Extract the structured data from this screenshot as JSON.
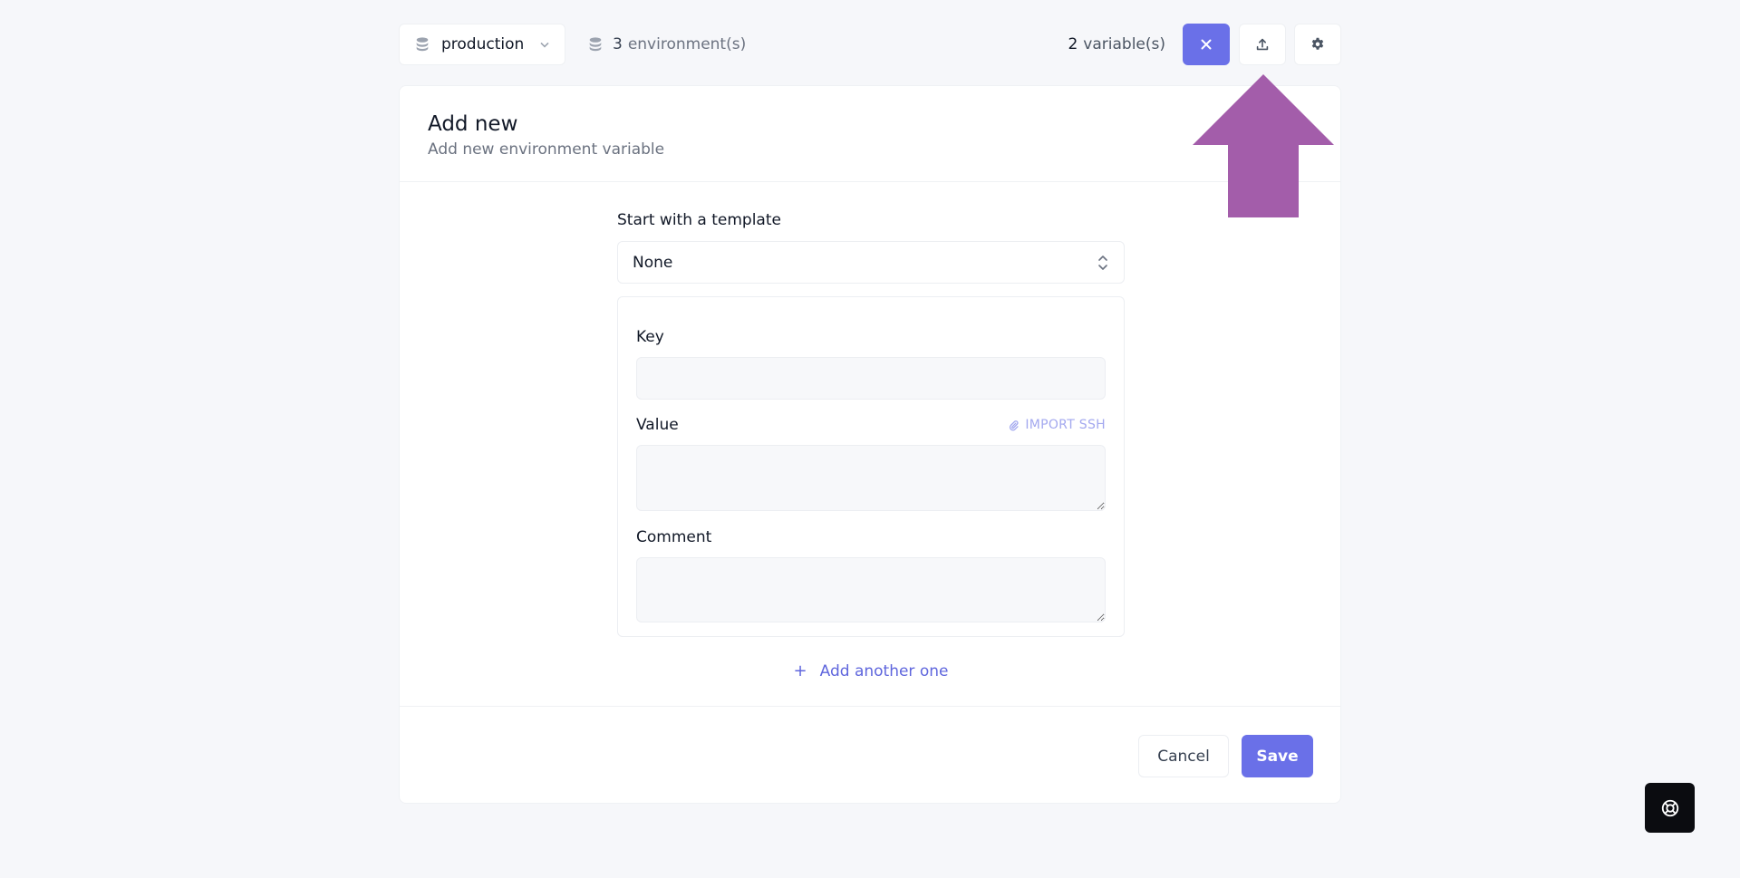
{
  "topbar": {
    "environment": {
      "selected": "production",
      "icon": "database-icon"
    },
    "environments_count": {
      "count": "3",
      "label": "environment(s)"
    },
    "variables_count": {
      "count": "2",
      "label": "variable(s)"
    },
    "buttons": {
      "close_icon": "close-icon",
      "upload_icon": "upload-icon",
      "settings_icon": "gear-icon"
    }
  },
  "card": {
    "title": "Add new",
    "subtitle": "Add new environment variable",
    "template": {
      "label": "Start with a template",
      "selected": "None"
    },
    "fields": {
      "key_label": "Key",
      "key_value": "",
      "value_label": "Value",
      "value_value": "",
      "import_ssh": "IMPORT SSH",
      "comment_label": "Comment",
      "comment_value": ""
    },
    "add_another": "Add another one",
    "footer": {
      "cancel": "Cancel",
      "save": "Save"
    }
  },
  "colors": {
    "accent": "#6a70e8",
    "annotation_arrow": "#a35daa",
    "background": "#f6f7fa"
  },
  "help_button_icon": "lifebuoy-icon"
}
